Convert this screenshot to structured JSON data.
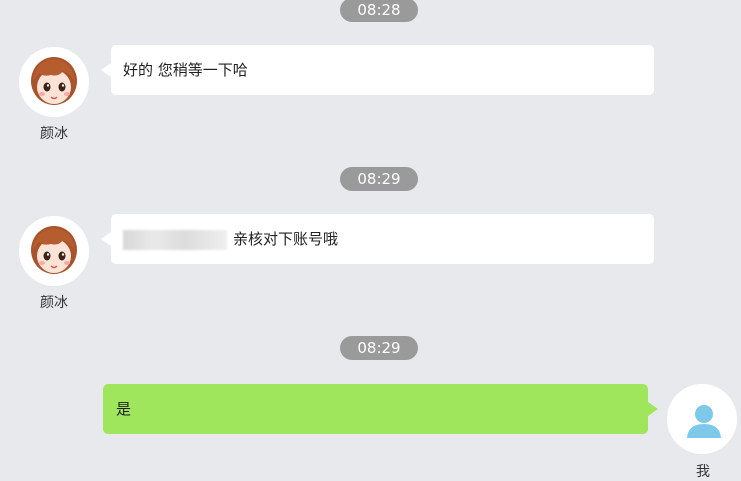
{
  "messages": [
    {
      "time": "08:28",
      "sender": "颜冰",
      "text": "好的 您稍等一下哈",
      "direction": "incoming"
    },
    {
      "time": "08:29",
      "sender": "颜冰",
      "text": "亲核对下账号哦",
      "direction": "incoming",
      "has_redacted_prefix": true
    },
    {
      "time": "08:29",
      "sender": "我",
      "text": "是",
      "direction": "outgoing"
    }
  ],
  "colors": {
    "background": "#e8e9ed",
    "incoming_bubble": "#ffffff",
    "outgoing_bubble": "#9fe65d",
    "time_pill": "#9a9a9a",
    "self_avatar_icon": "#7ec8ea"
  },
  "icons": {
    "contact_avatar": "cartoon-girl-avatar",
    "self_avatar": "user-silhouette-icon"
  }
}
